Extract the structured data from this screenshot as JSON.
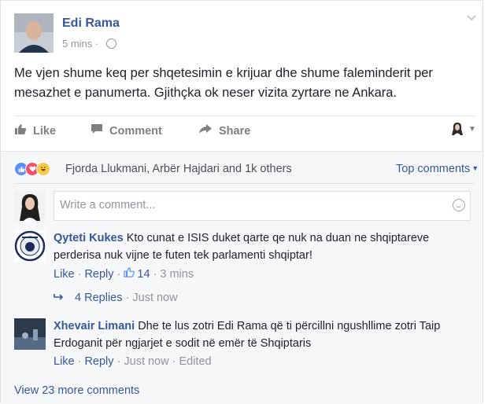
{
  "post": {
    "author": "Edi Rama",
    "time": "5 mins",
    "text": "Me vjen shume keq per shqetesimin e krijuar dhe shume faleminderit per mesazhet e panumerta. Gjithçka ok neser vizita zyrtare ne Ankara."
  },
  "actions": {
    "like": "Like",
    "comment": "Comment",
    "share": "Share"
  },
  "reactions": {
    "summary": "Fjorda Llukmani, Arbër Hajdari and 1k others",
    "icons": [
      "like-reaction-icon",
      "love-reaction-icon",
      "haha-reaction-icon"
    ],
    "sort_label": "Top comments"
  },
  "composer": {
    "placeholder": "Write a comment..."
  },
  "comments": [
    {
      "author": "Qyteti Kukes",
      "text": "Kto cunat e ISIS duket qarte qe nuk na duan ne shqiptareve perderisa nuk vijne te futen tek parlamenti shqiptar!",
      "like": "Like",
      "reply": "Reply",
      "likes": "14",
      "time": "3 mins",
      "replies": {
        "label": "4 Replies",
        "time": "Just now"
      }
    },
    {
      "author": "Xhevair Limani",
      "text": "Dhe te lus zotri Edi Rama që ti përcillni ngushllime zotri Taip Erdoganit për ngjarjet e sodit në emër të Shqiptaris",
      "like": "Like",
      "reply": "Reply",
      "time": "Just now",
      "edited": "Edited"
    }
  ],
  "more_comments": "View 23 more comments",
  "colors": {
    "link": "#365899",
    "meta": "#90949c",
    "like_blue": "#5890ff"
  }
}
